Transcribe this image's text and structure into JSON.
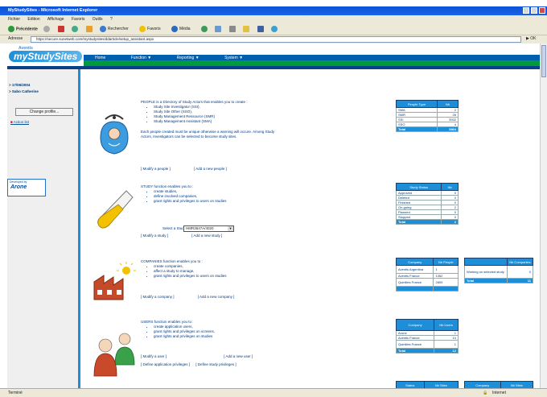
{
  "window": {
    "title": "MyStudySites - Microsoft Internet Explorer",
    "min": "_",
    "max": "□",
    "close": "x"
  },
  "menu": [
    "Fichier",
    "Edition",
    "Affichage",
    "Favoris",
    "Outils",
    "?"
  ],
  "toolbar": {
    "back": "Précédente",
    "search": "Rechercher",
    "favorites": "Favoris",
    "media": "Média"
  },
  "address": {
    "label": "Adresse",
    "url": "https://secure.sunetweb.com/mystudysites/ddarticle/setup_assistant.aspx",
    "go": "OK"
  },
  "logo": {
    "small": "Aventis",
    "big": "myStudySites"
  },
  "nav": [
    "Home",
    "Function ▼",
    "Reporting ▼",
    "System ▼"
  ],
  "sidebar": {
    "date": "> 17/06/2004",
    "user": "> Sabo Catherine",
    "change_profile": "Change profile...",
    "action_list": "Action list",
    "dev_label": "Developed by",
    "dev_brand": "Arone"
  },
  "people": {
    "intro": "PEOPLE is a Directory of Study Actors that enables you to create :",
    "items": [
      "Study Site Investigator (SSI),",
      "Study Site Other (SSO),",
      "Study Management Ressource (SMR)",
      "Study Management Assistant (SMA)"
    ],
    "note": "Each people created must be unique otherwise a warning will occure. Among Study Actors, Investigators can be selected to become study sites.",
    "link1": "[ Modify a people ]",
    "link2": "[ Add a new people ]"
  },
  "study": {
    "intro": "STUDY function enables you to :",
    "items": [
      "create studies,",
      "define involved companies,",
      "grant rights and privileges to users on studies"
    ],
    "select_label": "Select a Study :",
    "select_value": "HMR3647A/4020",
    "link1": "[ Modify a study ]",
    "link2": "[ Add a new study ]"
  },
  "companies": {
    "intro": "COMPANIES function enables you to :",
    "items": [
      "create companies,",
      "affect a study to manage,",
      "grant rights and privileges to users on studies"
    ],
    "link1": "[ Modify a company ]",
    "link2": "[ Add a new company ]"
  },
  "users": {
    "intro": "USERS function enables you to :",
    "items": [
      "create application users,",
      "grant rights and privileges on screens,",
      "grant rights and privileges on studies"
    ],
    "link1": "[ Modify a user ]",
    "link2": "[ Add a new user ]",
    "link3": "[ Define application privileges ]",
    "link4": "[ Define study privileges ]"
  },
  "table_people": {
    "headers": [
      "People Type",
      "Nb"
    ],
    "rows": [
      [
        "SMA",
        "2"
      ],
      [
        "SMR",
        "26"
      ],
      [
        "SSI",
        "3932"
      ],
      [
        "SSO",
        "4"
      ]
    ],
    "total": [
      "Total",
      "3964"
    ]
  },
  "table_study_status": {
    "headers": [
      "Study Status",
      "Nb"
    ],
    "rows": [
      [
        "Approved",
        "0"
      ],
      [
        "Deleted",
        "0"
      ],
      [
        "Finished",
        "0"
      ],
      [
        "On-going",
        "2"
      ],
      [
        "Planned",
        "0"
      ],
      [
        "Stopped",
        "0"
      ]
    ],
    "total": [
      "Total",
      "2"
    ]
  },
  "table_company_people": {
    "headers": [
      "Company",
      "Nb People"
    ],
    "rows": [
      [
        "Aventis Argentina",
        "1"
      ],
      [
        "Aventis France",
        "1352"
      ],
      [
        "Quintiles France",
        "2609"
      ]
    ]
  },
  "table_company_small": {
    "headers": [
      "",
      "Nb Companies"
    ],
    "rows": [
      [
        "Working on selected study",
        "0"
      ]
    ],
    "total": [
      "Total",
      "11"
    ]
  },
  "table_company_users": {
    "headers": [
      "Company",
      "Nb Users"
    ],
    "rows": [
      [
        "Arone",
        "1"
      ],
      [
        "Aventis France",
        "10"
      ],
      [
        "Quintiles France",
        "1"
      ]
    ],
    "total": [
      "Total",
      "12"
    ]
  },
  "table_bottom": {
    "headers1": [
      "Status",
      "Nb Sites"
    ],
    "headers2": [
      "Company",
      "Nb Sites"
    ]
  },
  "status": {
    "left": "Terminé",
    "right": "Internet"
  }
}
